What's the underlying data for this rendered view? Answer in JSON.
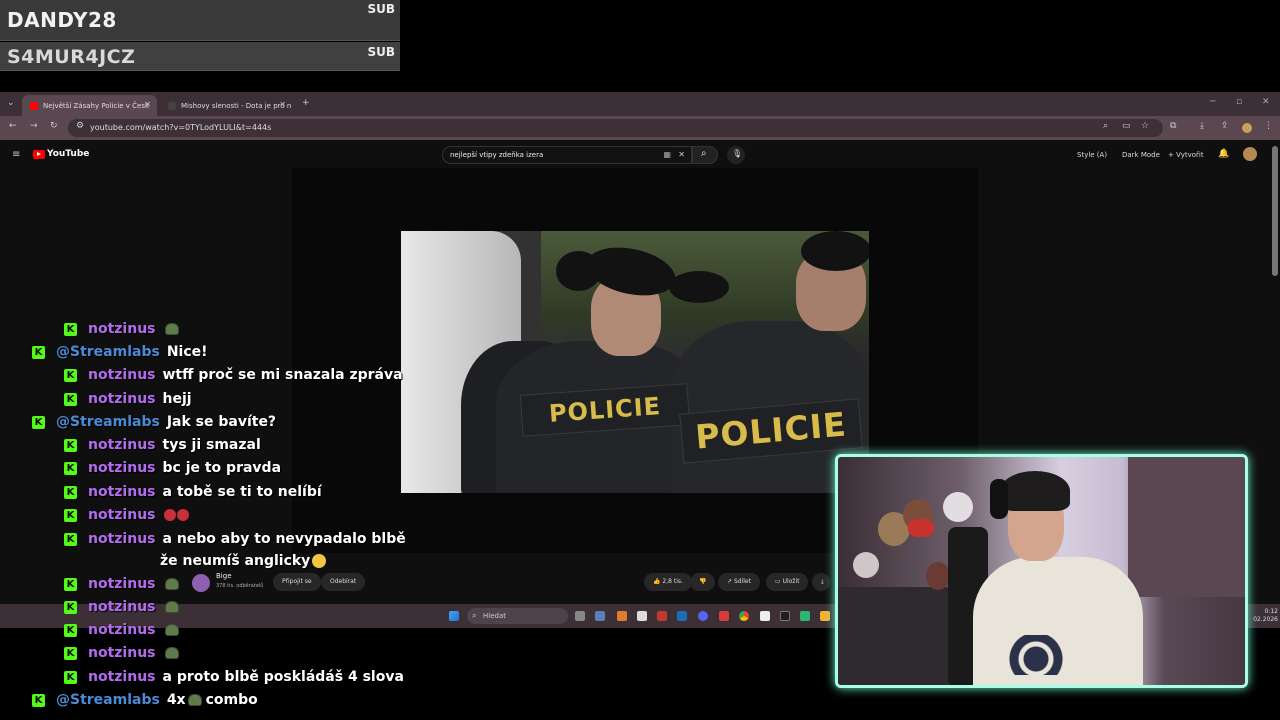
{
  "alerts": [
    {
      "name": "DANDY28",
      "tag": "SUB"
    },
    {
      "name": "S4MUR4JCZ",
      "tag": "SUB"
    }
  ],
  "browser": {
    "tabs": [
      {
        "title": "Největší Zásahy Policie v Česk"
      },
      {
        "title": "Mishovy slenosti - Dota je pro n"
      }
    ],
    "url": "youtube.com/watch?v=0TYLodYLULI&t=444s"
  },
  "youtube": {
    "logo": "YouTube",
    "search_value": "nejlepší vtipy zdeňka izera",
    "style_label": "Style (A)",
    "dark_mode_label": "Dark Mode",
    "create_label": "Vytvořit",
    "video_patch_text": "POLICIE",
    "video_patch_partial": "PO",
    "channel": {
      "name": "Bige",
      "subscribers": "378 tis. odběratelů"
    },
    "join_label": "Připojit se",
    "subscribe_label": "Odebírat",
    "likes": "2,8 tis.",
    "share_label": "Sdílet",
    "save_label": "Uložit"
  },
  "taskbar": {
    "search_placeholder": "Hledat",
    "time": "0:12",
    "date": "02.2026"
  },
  "chat": [
    {
      "user": "notzinus",
      "text": "",
      "emote": "frog"
    },
    {
      "user": "@Streamlabs",
      "text": "Nice!"
    },
    {
      "user": "notzinus",
      "text": "wtff proč se mi snazala zpráva"
    },
    {
      "user": "notzinus",
      "text": "hejj"
    },
    {
      "user": "@Streamlabs",
      "text": "Jak se bavíte?"
    },
    {
      "user": "notzinus",
      "text": "tys ji smazal"
    },
    {
      "user": "notzinus",
      "text": "bc je to pravda"
    },
    {
      "user": "notzinus",
      "text": "a tobě se ti to nelíbí"
    },
    {
      "user": "notzinus",
      "text": "",
      "emote": "angry"
    },
    {
      "user": "notzinus",
      "text": "a nebo aby to nevypadalo blbě",
      "text2": "že neumíš anglicky"
    },
    {
      "user": "notzinus",
      "text": "",
      "emote": "frog"
    },
    {
      "user": "notzinus",
      "text": "",
      "emote": "frog"
    },
    {
      "user": "notzinus",
      "text": "",
      "emote": "frog"
    },
    {
      "user": "notzinus",
      "text": "",
      "emote": "frog"
    },
    {
      "user": "notzinus",
      "text": "a proto blbě poskládáš 4 slova"
    },
    {
      "user": "@Streamlabs",
      "text": "4x",
      "text_after": "combo",
      "emote": "frog"
    }
  ],
  "kick_badge": "K"
}
